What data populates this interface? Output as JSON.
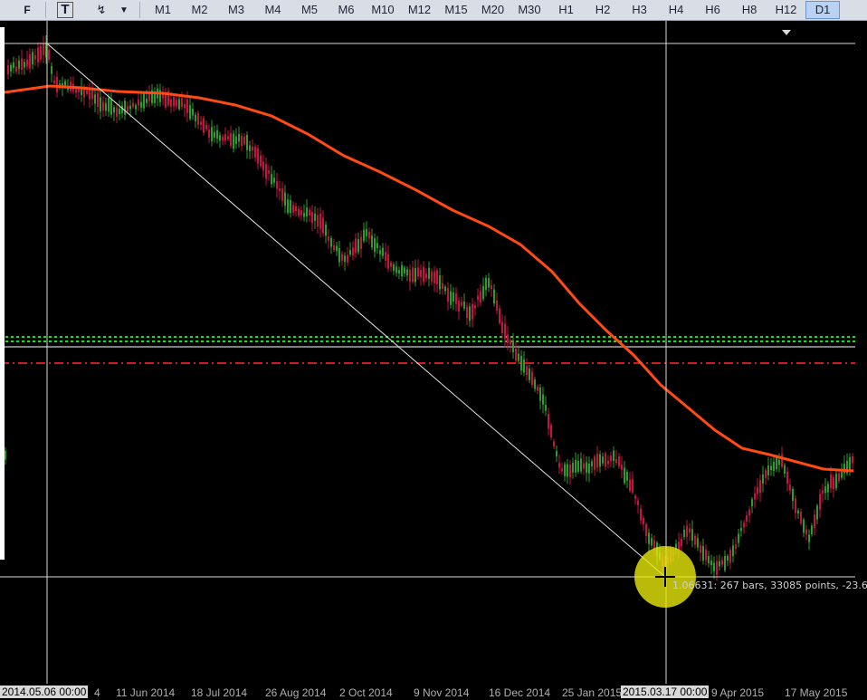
{
  "toolbar": {
    "tools": [
      {
        "name": "periodicity-icon",
        "glyph": "F"
      },
      {
        "name": "text-label-icon",
        "glyph": "T"
      },
      {
        "name": "arrows-tool-icon",
        "glyph": "↯"
      },
      {
        "name": "dropdown-arrow-icon",
        "glyph": "▼"
      }
    ],
    "timeframes": [
      "M1",
      "M2",
      "M3",
      "M4",
      "M5",
      "M6",
      "M10",
      "M12",
      "M15",
      "M20",
      "M30",
      "H1",
      "H2",
      "H3",
      "H4",
      "H6",
      "H8",
      "H12",
      "D1"
    ],
    "active_timeframe": "D1"
  },
  "dates": {
    "labels": [
      "4",
      "11 Jun 2014",
      "18 Jul 2014",
      "26 Aug 2014",
      "2 Oct 2014",
      "9 Nov 2014",
      "16 Dec 2014",
      "25 Jan 2015",
      "9 Apr 2015",
      "17 May 2015"
    ],
    "crosshair_left": "2014.05.06 00:00",
    "crosshair_right": "2015.03.17 00:00"
  },
  "readout": "1.06631: 267 bars, 33085 points, -23.6",
  "colors": {
    "background": "#000000",
    "moving_average": "#ff4a14",
    "candle_up": "#2f9a2f",
    "candle_down": "#c0173d",
    "level_green": "#2bd62b",
    "level_red": "#d01c1c",
    "crosshair": "#d8d8d8",
    "highlight": "#e8e80a"
  }
}
